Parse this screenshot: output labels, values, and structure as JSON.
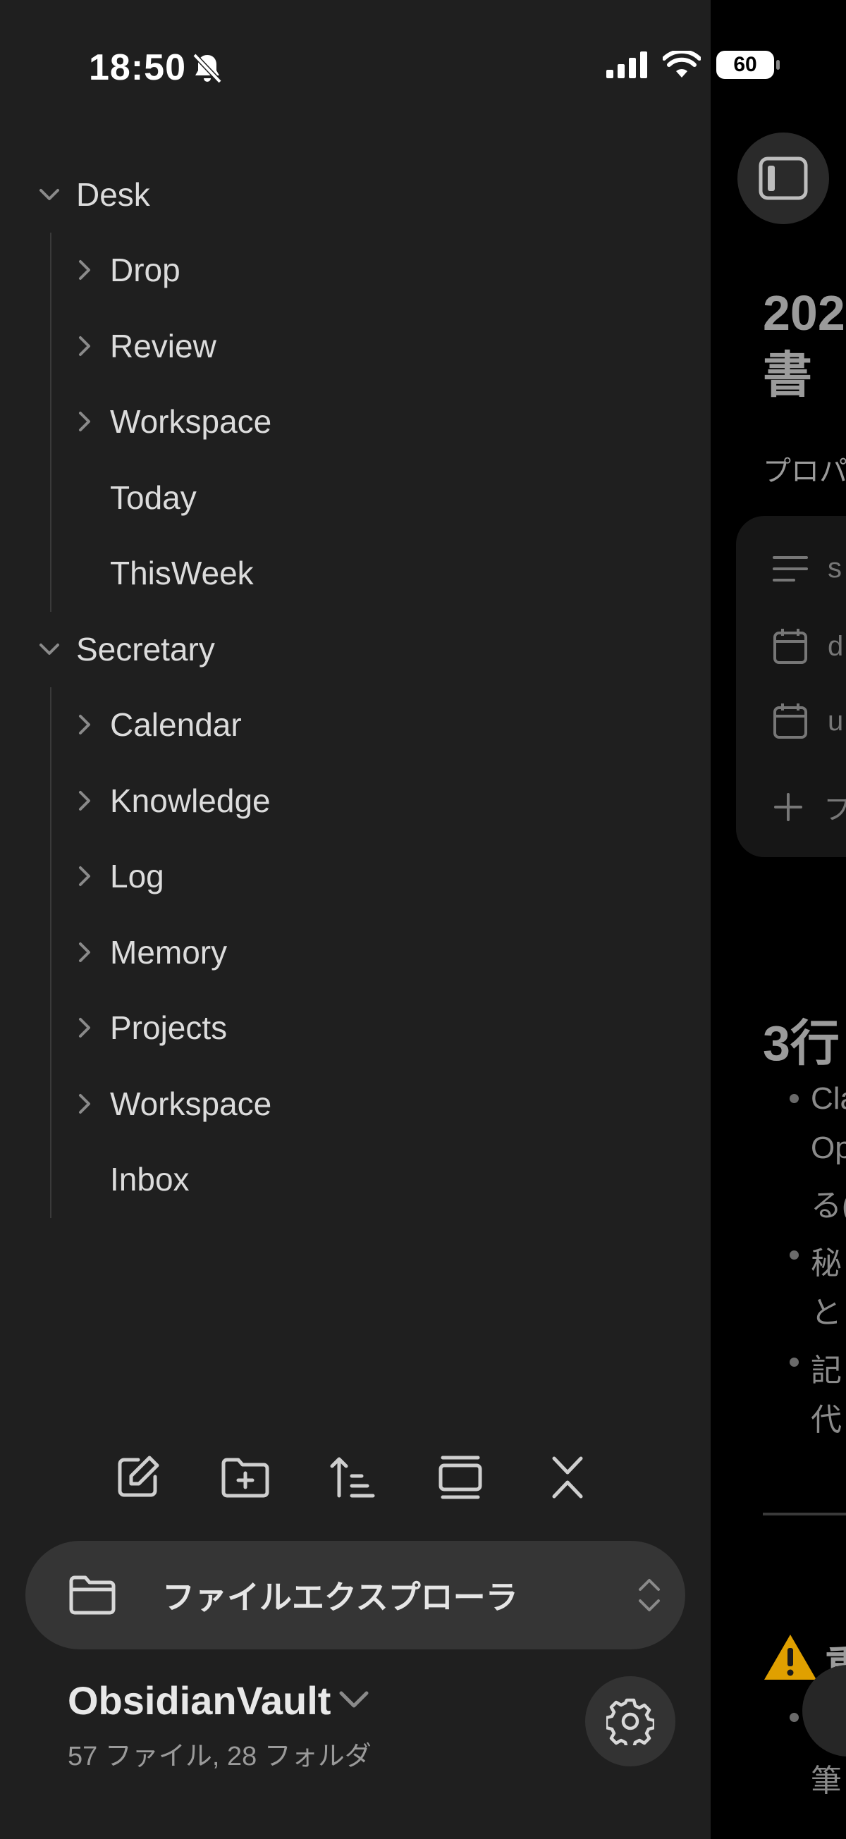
{
  "status_bar": {
    "time": "18:50",
    "battery": "60",
    "icons": [
      "bell-slash-icon",
      "cellular-signal-icon",
      "wifi-icon",
      "battery-icon"
    ]
  },
  "file_tree": {
    "groups": [
      {
        "name": "Desk",
        "expanded": true,
        "children": [
          {
            "name": "Drop",
            "type": "folder"
          },
          {
            "name": "Review",
            "type": "folder"
          },
          {
            "name": "Workspace",
            "type": "folder"
          },
          {
            "name": "Today",
            "type": "file"
          },
          {
            "name": "ThisWeek",
            "type": "file"
          }
        ]
      },
      {
        "name": "Secretary",
        "expanded": true,
        "children": [
          {
            "name": "Calendar",
            "type": "folder"
          },
          {
            "name": "Knowledge",
            "type": "folder"
          },
          {
            "name": "Log",
            "type": "folder"
          },
          {
            "name": "Memory",
            "type": "folder"
          },
          {
            "name": "Projects",
            "type": "folder"
          },
          {
            "name": "Workspace",
            "type": "folder"
          },
          {
            "name": "Inbox",
            "type": "file"
          }
        ]
      }
    ]
  },
  "toolbar": {
    "actions": [
      "new-note-icon",
      "new-folder-icon",
      "sort-icon",
      "toggle-view-icon",
      "collapse-all-icon"
    ]
  },
  "view_switcher": {
    "label": "ファイルエクスプローラ",
    "icon": "folder-icon"
  },
  "vault": {
    "name": "ObsidianVault",
    "stats": "57 ファイル, 28 フォルダ"
  },
  "background_note": {
    "title_line1": "202",
    "title_line2": "書",
    "subtitle": "プロパ",
    "properties": [
      {
        "icon": "text-lines-icon",
        "name": "s"
      },
      {
        "icon": "calendar-icon",
        "name": "d"
      },
      {
        "icon": "calendar-icon",
        "name": "u"
      }
    ],
    "add_property": "フ",
    "heading": "3行",
    "list_lines": [
      "Cla",
      "Op",
      "る(",
      "秘",
      "と",
      "記",
      "代"
    ],
    "callout_heading": "重",
    "callout_line": "筆"
  },
  "colors": {
    "drawer_bg": "#1f1f1f",
    "note_bg": "#000000",
    "warning": "#e0a000"
  }
}
